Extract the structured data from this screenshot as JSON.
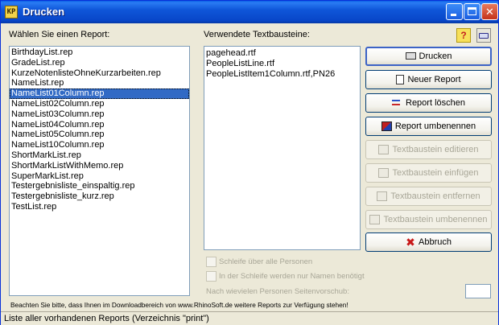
{
  "window": {
    "title": "Drucken",
    "app_icon_text": "KP"
  },
  "labels": {
    "choose_report": "Wählen Sie einen Report:",
    "used_text_blocks": "Verwendete Textbausteine:"
  },
  "reports": [
    "BirthdayList.rep",
    "GradeList.rep",
    "KurzeNotenlisteOhneKurzarbeiten.rep",
    "NameList.rep",
    "NameList01Column.rep",
    "NameList02Column.rep",
    "NameList03Column.rep",
    "NameList04Column.rep",
    "NameList05Column.rep",
    "NameList10Column.rep",
    "ShortMarkList.rep",
    "ShortMarkListWithMemo.rep",
    "SuperMarkList.rep",
    "Testergebnisliste_einspaltig.rep",
    "Testergebnisliste_kurz.rep",
    "TestList.rep"
  ],
  "selected_report_index": 4,
  "text_blocks": [
    "pagehead.rtf",
    "PeopleListLine.rtf",
    "PeopleListItem1Column.rtf,PN26"
  ],
  "buttons": {
    "print": "Drucken",
    "new_report": "Neuer Report",
    "delete_report": "Report löschen",
    "rename_report": "Report umbenennen",
    "edit_text_block": "Textbaustein editieren",
    "insert_text_block": "Textbaustein einfügen",
    "remove_text_block": "Textbaustein entfernen",
    "rename_text_block": "Textbaustein umbenennen",
    "cancel": "Abbruch"
  },
  "options": {
    "loop_all_persons": "Schleife über alle Personen",
    "names_only_in_loop": "In der Schleife werden nur Namen benötigt",
    "page_break_after": "Nach wievielen Personen Seitenvorschub:",
    "page_break_value": ""
  },
  "note": "Beachten Sie bitte, dass Ihnen im Downloadbereich von www.RhinoSoft.de weitere Reports zur Verfügung stehen!",
  "status_bar": "Liste aller vorhandenen Reports (Verzeichnis \"print\")",
  "icons": {
    "help": "?",
    "close": "✕"
  }
}
